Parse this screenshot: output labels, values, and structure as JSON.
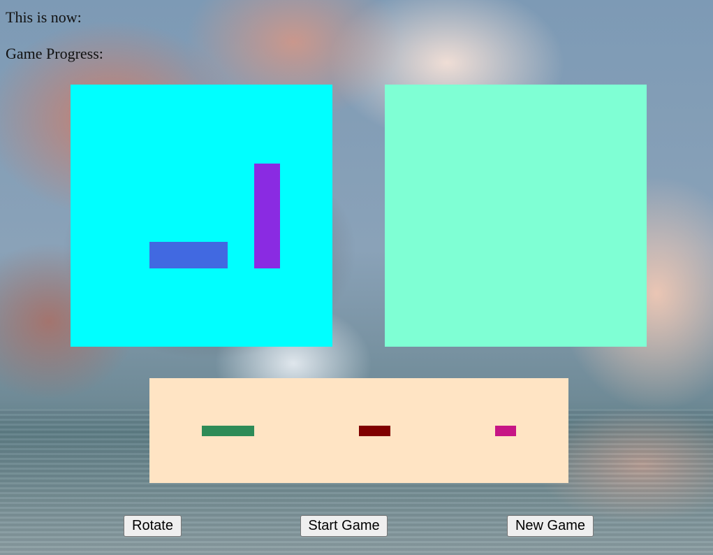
{
  "header": {
    "now_label": "This is now:",
    "progress_label": "Game Progress:"
  },
  "boards": {
    "player": {
      "color": "#00ffff"
    },
    "enemy": {
      "color": "#7fffd4"
    }
  },
  "placed_ships": [
    {
      "name": "blue-ship",
      "color": "#4169e1",
      "orientation": "horizontal"
    },
    {
      "name": "purple-ship",
      "color": "#8a2be2",
      "orientation": "vertical"
    }
  ],
  "dock": {
    "color": "#ffe4c4",
    "ships": [
      {
        "name": "green-ship",
        "color": "#2e8b57"
      },
      {
        "name": "maroon-ship",
        "color": "#800000"
      },
      {
        "name": "magenta-ship",
        "color": "#c71585"
      }
    ]
  },
  "buttons": {
    "rotate": "Rotate",
    "start": "Start Game",
    "new_game": "New Game"
  }
}
